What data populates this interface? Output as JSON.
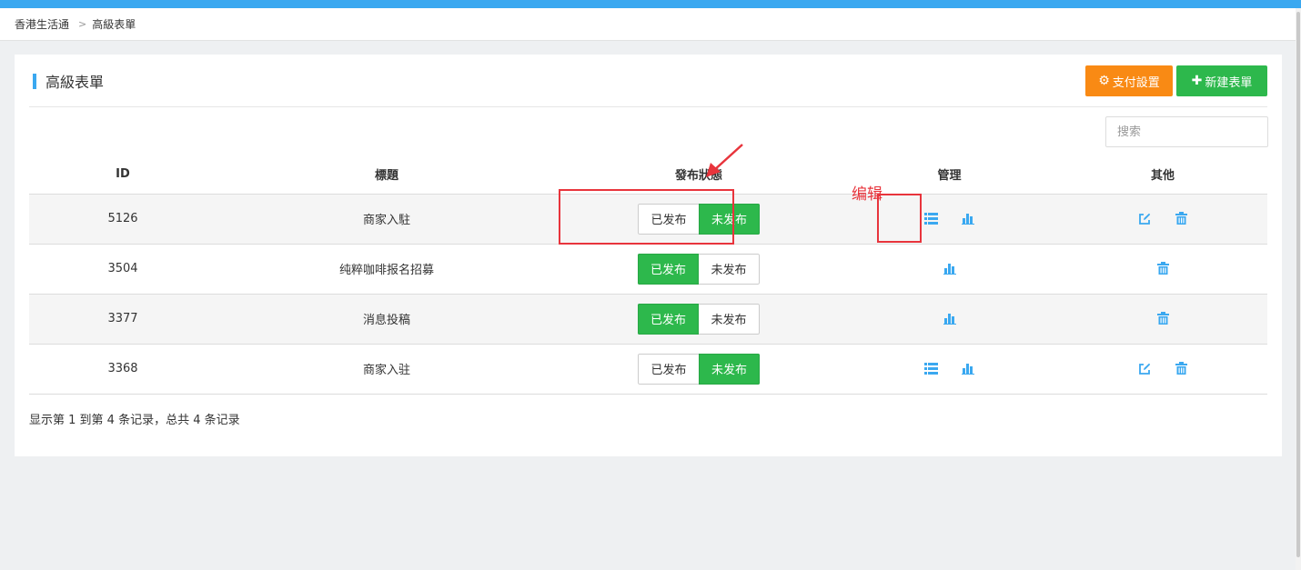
{
  "breadcrumb": {
    "home": "香港生活通",
    "separator": ">",
    "current": "高級表單"
  },
  "panel": {
    "title": "高級表單",
    "pay_button": "支付設置",
    "new_button": "新建表單",
    "search_placeholder": "搜索"
  },
  "table": {
    "headers": [
      "ID",
      "標題",
      "發布狀態",
      "管理",
      "其他"
    ],
    "published_label": "已发布",
    "unpublished_label": "未发布",
    "rows": [
      {
        "id": "5126",
        "title": "商家入駐",
        "status": "unpublished",
        "manage_icons": [
          "list-icon",
          "bar-chart-icon"
        ],
        "other_icons": [
          "edit-icon",
          "trash-icon"
        ]
      },
      {
        "id": "3504",
        "title": "纯粹咖啡报名招募",
        "status": "published",
        "manage_icons": [
          "bar-chart-icon"
        ],
        "other_icons": [
          "trash-icon"
        ]
      },
      {
        "id": "3377",
        "title": "消息投稿",
        "status": "published",
        "manage_icons": [
          "bar-chart-icon"
        ],
        "other_icons": [
          "trash-icon"
        ]
      },
      {
        "id": "3368",
        "title": "商家入驻",
        "status": "unpublished",
        "manage_icons": [
          "list-icon",
          "bar-chart-icon"
        ],
        "other_icons": [
          "edit-icon",
          "trash-icon"
        ]
      }
    ]
  },
  "footer": {
    "info": "显示第 1 到第 4 条记录，总共 4 条记录"
  },
  "annotation": {
    "label": "编辑"
  },
  "colors": {
    "accent": "#3aa8f0",
    "orange": "#f98a14",
    "green": "#2db84c",
    "icon": "#3aa8f0",
    "annotation": "#e8343c"
  }
}
